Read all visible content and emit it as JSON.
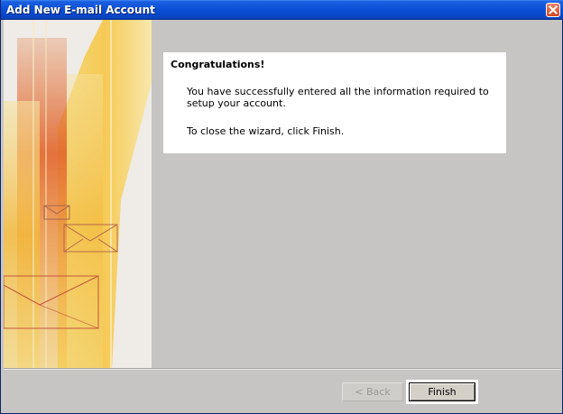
{
  "window": {
    "title": "Add New E-mail Account"
  },
  "message": {
    "heading": "Congratulations!",
    "line1": "You have successfully entered all the information required to setup your account.",
    "line2": "To close the wizard, click Finish."
  },
  "buttons": {
    "back_label": "< Back",
    "finish_label": "Finish"
  },
  "icons": {
    "close": "close-icon",
    "envelope": "envelope-icon"
  },
  "colors": {
    "titlebar": "#0a4fd6",
    "close_button": "#d2461e",
    "art_orange": "#e8702a",
    "art_yellow": "#f5c93a"
  }
}
